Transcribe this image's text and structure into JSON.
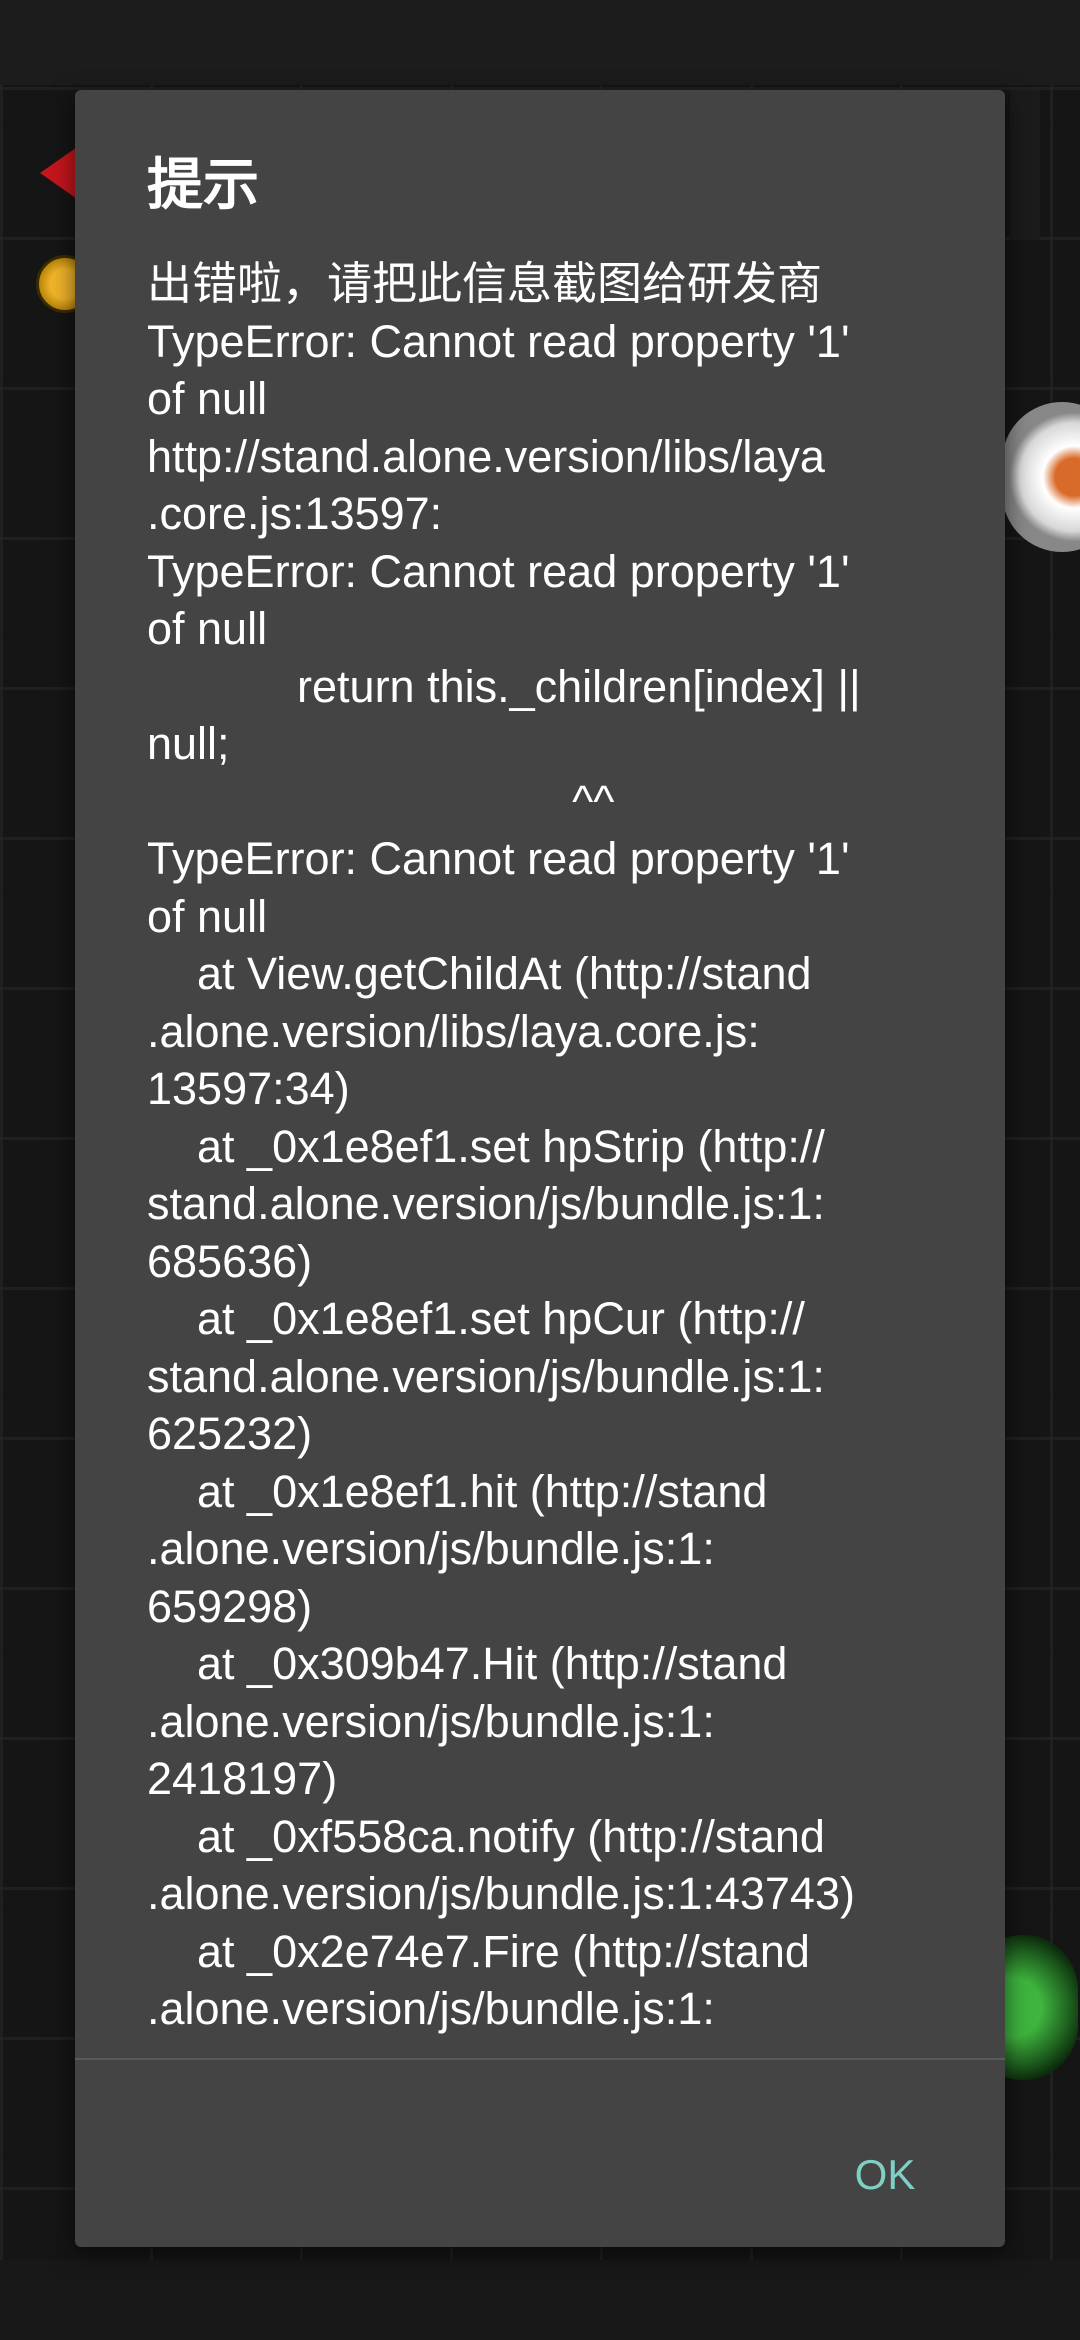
{
  "dialog": {
    "title": "提示",
    "message": "出错啦，请把此信息截图给研发商\nTypeError: Cannot read property '1'\nof null\nhttp://stand.alone.version/libs/laya\n.core.js:13597:\nTypeError: Cannot read property '1'\nof null\n            return this._children[index] ||\nnull;\n                                  ^^\nTypeError: Cannot read property '1'\nof null\n    at View.getChildAt (http://stand\n.alone.version/libs/laya.core.js:\n13597:34)\n    at _0x1e8ef1.set hpStrip (http://\nstand.alone.version/js/bundle.js:1:\n685636)\n    at _0x1e8ef1.set hpCur (http://\nstand.alone.version/js/bundle.js:1:\n625232)\n    at _0x1e8ef1.hit (http://stand\n.alone.version/js/bundle.js:1:\n659298)\n    at _0x309b47.Hit (http://stand\n.alone.version/js/bundle.js:1:\n2418197)\n    at _0xf558ca.notify (http://stand\n.alone.version/js/bundle.js:1:43743)\n    at _0x2e74e7.Fire (http://stand\n.alone.version/js/bundle.js:1:",
    "ok_label": "OK"
  },
  "colors": {
    "dialog_bg": "#444444",
    "accent": "#7fcfc4"
  }
}
